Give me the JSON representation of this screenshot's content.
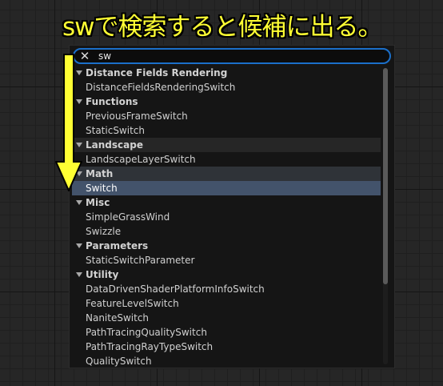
{
  "caption": "swで検索すると候補に出る。",
  "search": {
    "close_icon": "close-icon",
    "value": "sw"
  },
  "list": [
    {
      "type": "category",
      "label": "Distance Fields Rendering",
      "style": "plain"
    },
    {
      "type": "item",
      "label": "DistanceFieldsRenderingSwitch"
    },
    {
      "type": "category",
      "label": "Functions",
      "style": "plain"
    },
    {
      "type": "item",
      "label": "PreviousFrameSwitch"
    },
    {
      "type": "item",
      "label": "StaticSwitch"
    },
    {
      "type": "category",
      "label": "Landscape",
      "style": "shaded"
    },
    {
      "type": "item",
      "label": "LandscapeLayerSwitch"
    },
    {
      "type": "category",
      "label": "Math",
      "style": "highlight"
    },
    {
      "type": "item",
      "label": "Switch",
      "selected": true
    },
    {
      "type": "category",
      "label": "Misc",
      "style": "plain"
    },
    {
      "type": "item",
      "label": "SimpleGrassWind"
    },
    {
      "type": "item",
      "label": "Swizzle"
    },
    {
      "type": "category",
      "label": "Parameters",
      "style": "plain"
    },
    {
      "type": "item",
      "label": "StaticSwitchParameter"
    },
    {
      "type": "category",
      "label": "Utility",
      "style": "plain"
    },
    {
      "type": "item",
      "label": "DataDrivenShaderPlatformInfoSwitch"
    },
    {
      "type": "item",
      "label": "FeatureLevelSwitch"
    },
    {
      "type": "item",
      "label": "NaniteSwitch"
    },
    {
      "type": "item",
      "label": "PathTracingQualitySwitch"
    },
    {
      "type": "item",
      "label": "PathTracingRayTypeSwitch"
    },
    {
      "type": "item",
      "label": "QualitySwitch"
    }
  ],
  "colors": {
    "accent_search_border": "#1b6fc9",
    "selected_row": "#43536b",
    "annotation_yellow": "#ffff33"
  },
  "annotation": {
    "arrow_icon": "down-arrow-icon"
  }
}
